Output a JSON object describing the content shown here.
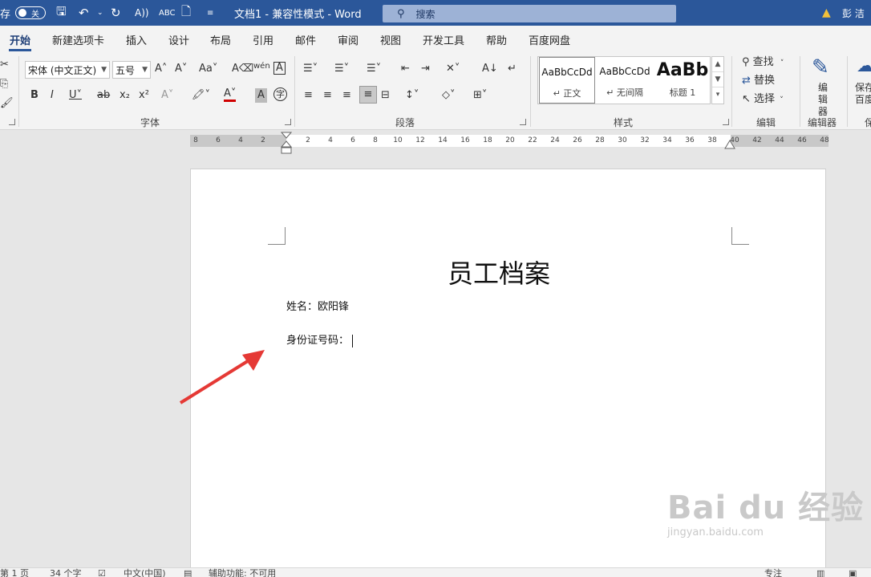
{
  "titlebar": {
    "autosave_label": "存",
    "autosave_state": "关",
    "doc_title": "文档1 - 兼容性模式 - Word",
    "search_placeholder": "搜索",
    "user_name": "彭 洁"
  },
  "tabs": [
    "开始",
    "新建选项卡",
    "插入",
    "设计",
    "布局",
    "引用",
    "邮件",
    "审阅",
    "视图",
    "开发工具",
    "帮助",
    "百度网盘"
  ],
  "ribbon": {
    "font_name": "宋体 (中文正文)",
    "font_size": "五号",
    "groups": {
      "font": "字体",
      "paragraph": "段落",
      "styles": "样式",
      "editing": "编辑",
      "editor": "编辑器",
      "save": "保"
    },
    "styles": [
      {
        "sample": "AaBbCcDd",
        "name": "↵ 正文"
      },
      {
        "sample": "AaBbCcDd",
        "name": "↵ 无间隔"
      },
      {
        "sample": "AaBb",
        "name": "标题 1"
      }
    ],
    "editing_items": {
      "find": "查找",
      "replace": "替换",
      "select": "选择"
    },
    "editor_label": "编辑器",
    "save_label": "保存百度"
  },
  "ruler_ticks": [
    "8",
    "6",
    "4",
    "2",
    "2",
    "4",
    "6",
    "8",
    "10",
    "12",
    "14",
    "16",
    "18",
    "20",
    "22",
    "24",
    "26",
    "28",
    "30",
    "32",
    "34",
    "36",
    "38",
    "40",
    "42",
    "44",
    "46",
    "48"
  ],
  "document": {
    "heading": "员工档案",
    "line1": "姓名：欧阳锋",
    "line2": "身份证号码："
  },
  "watermark": {
    "main": "Bai du 经验",
    "sub": "jingyan.baidu.com"
  },
  "statusbar": {
    "page": "第 1 页",
    "words": "34 个字",
    "language": "中文(中国)",
    "accessibility": "辅助功能: 不可用",
    "focus": "专注"
  },
  "colors": {
    "titlebar": "#2b579a",
    "ribbon": "#f3f3f3",
    "arrow": "#e53935"
  }
}
